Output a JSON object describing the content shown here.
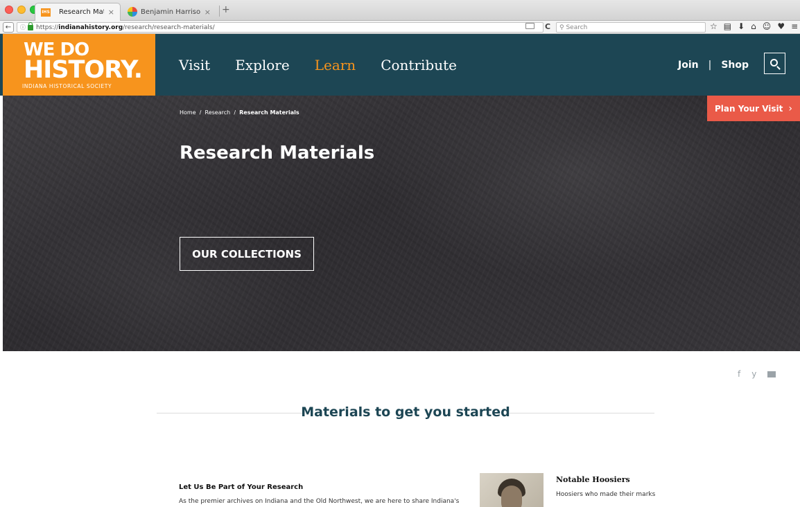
{
  "browser": {
    "tabs": [
      {
        "favicon": "IHS",
        "title": "Research Materials",
        "close": "×"
      },
      {
        "title": "Benjamin Harrison collectio...",
        "close": "×"
      }
    ],
    "new_tab": "+",
    "back": "←",
    "url_prefix": "https://",
    "url_domain": "indianahistory.org",
    "url_path": "/research/research-materials/",
    "reload": "C",
    "search_placeholder": "Search",
    "toolbar_icons": [
      "☆",
      "▤",
      "⬇",
      "⌂",
      "☺",
      "♥",
      "≡"
    ]
  },
  "header": {
    "logo_line1": "WE DO",
    "logo_line2": "HISTORY.",
    "logo_sub": "INDIANA HISTORICAL SOCIETY",
    "nav": [
      {
        "label": "Visit"
      },
      {
        "label": "Explore"
      },
      {
        "label": "Learn",
        "active": true
      },
      {
        "label": "Contribute"
      }
    ],
    "util": {
      "join": "Join",
      "sep": "|",
      "shop": "Shop"
    }
  },
  "hero": {
    "breadcrumb": {
      "home": "Home",
      "sep": "/",
      "research": "Research",
      "current": "Research Materials"
    },
    "title": "Research Materials",
    "cta": "OUR COLLECTIONS",
    "plan_visit": "Plan Your Visit",
    "plan_visit_chev": "›"
  },
  "share": {
    "facebook": "f",
    "twitter": "y"
  },
  "section": {
    "heading": "Materials to get you started"
  },
  "card": {
    "title": "Let Us Be Part of Your Research",
    "body": "As the premier archives on Indiana and the Old Northwest, we are here to share Indiana's"
  },
  "notable": {
    "title": "Notable Hoosiers",
    "body": "Hoosiers who made their marks"
  },
  "colors": {
    "brand_orange": "#f7941d",
    "header_teal": "#1d4654",
    "accent_red": "#ea5a48"
  }
}
